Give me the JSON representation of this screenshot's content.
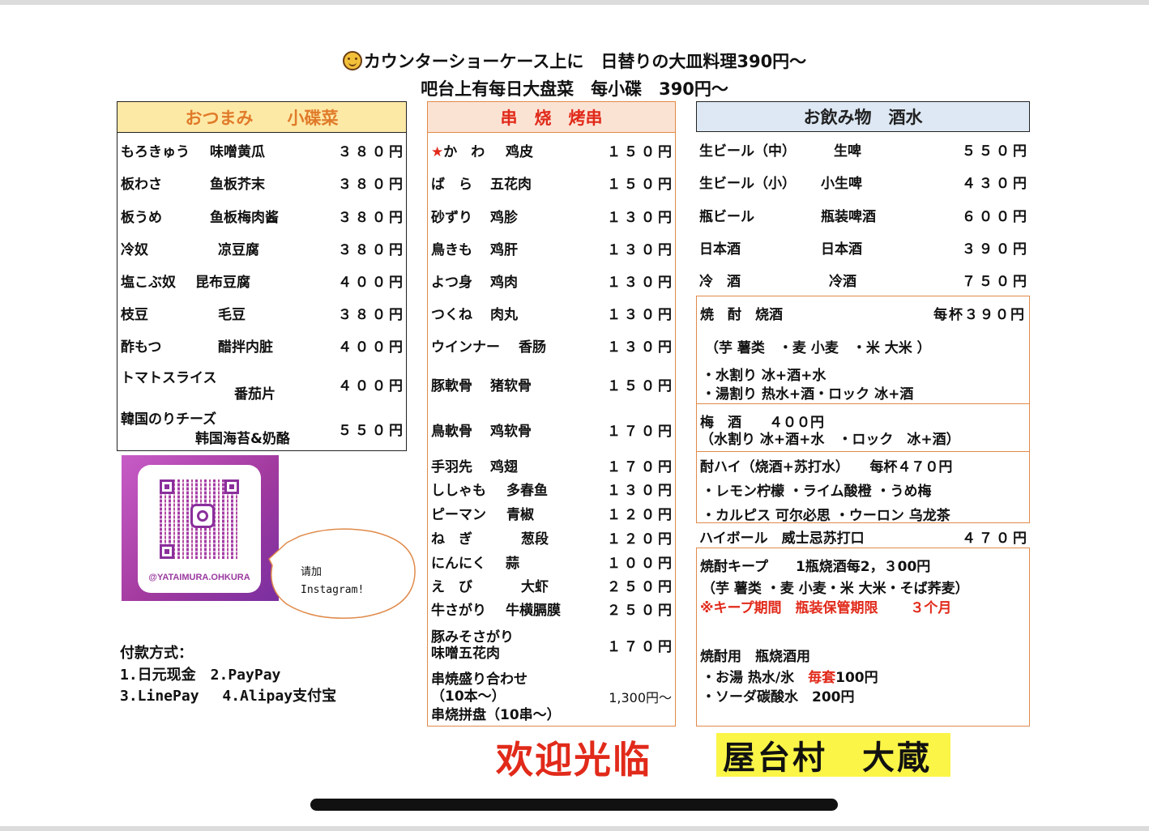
{
  "header": {
    "line1": "カウンターショーケース上に　日替りの大皿料理390円～",
    "line2": "吧台上有每日大盘菜　每小碟　390円～"
  },
  "snacks": {
    "title": "おつまみ　　小碟菜",
    "items": [
      {
        "jp": "もろきゅう",
        "cn": "味噌黄瓜",
        "price": "３８０円"
      },
      {
        "jp": "板わさ",
        "cn": "鱼板芥末",
        "price": "３８０円"
      },
      {
        "jp": "板うめ",
        "cn": "鱼板梅肉酱",
        "price": "３８０円"
      },
      {
        "jp": "冷奴",
        "cn": "凉豆腐",
        "price": "３８０円"
      },
      {
        "jp": "塩こぶ奴",
        "cn": "昆布豆腐",
        "price": "４００円"
      },
      {
        "jp": "枝豆",
        "cn": "毛豆",
        "price": "３８０円"
      },
      {
        "jp": "酢もつ",
        "cn": "醋拌内脏",
        "price": "４００円"
      },
      {
        "jp": "トマトスライス",
        "cn": "番茄片",
        "price": "４００円"
      },
      {
        "jp": "韓国のりチーズ",
        "cn": "韩国海苔&奶酪",
        "price": "５５０円"
      }
    ]
  },
  "skewers": {
    "title": "串　烧　烤串",
    "star": "★",
    "items": [
      {
        "jp": "か　わ",
        "cn": "鸡皮",
        "price": "１５０円"
      },
      {
        "jp": "ば　ら",
        "cn": "五花肉",
        "price": "１５０円"
      },
      {
        "jp": "砂ずり",
        "cn": "鸡胗",
        "price": "１３０円"
      },
      {
        "jp": "鳥きも",
        "cn": "鸡肝",
        "price": "１３０円"
      },
      {
        "jp": "よつ身",
        "cn": "鸡肉",
        "price": "１３０円"
      },
      {
        "jp": "つくね",
        "cn": "肉丸",
        "price": "１３０円"
      },
      {
        "jp": "ウインナー",
        "cn": "香肠",
        "price": "１３０円"
      },
      {
        "jp": "豚軟骨",
        "cn": "猪软骨",
        "price": "１５０円"
      },
      {
        "jp": "鳥軟骨",
        "cn": "鸡软骨",
        "price": "１７０円"
      },
      {
        "jp": "手羽先",
        "cn": "鸡翅",
        "price": "１７０円"
      },
      {
        "jp": "ししゃも",
        "cn": "多春鱼",
        "price": "１３０円"
      },
      {
        "jp": "ピーマン",
        "cn": "青椒",
        "price": "１２０円"
      },
      {
        "jp": "ね　ぎ",
        "cn": "葱段",
        "price": "１２０円"
      },
      {
        "jp": "にんにく",
        "cn": "蒜",
        "price": "１００円"
      },
      {
        "jp": "え　び",
        "cn": "大虾",
        "price": "２５０円"
      },
      {
        "jp": "牛さがり",
        "cn": "牛横膈膜",
        "price": "２５０円"
      }
    ],
    "pork": {
      "jp": "豚みそさがり",
      "cn": "味噌五花肉",
      "price": "１７０円"
    },
    "platter": {
      "jp1": "串焼盛り合わせ",
      "jp2": "（10本～）",
      "cn": "串烧拼盘（10串～）",
      "price": "1,300円～"
    }
  },
  "drinks": {
    "title": "お飲み物　酒水",
    "beers": [
      {
        "jp": "生ビール（中）",
        "cn": "生啤",
        "price": "５５０円"
      },
      {
        "jp": "生ビール（小）",
        "cn": "小生啤",
        "price": "４３０円"
      },
      {
        "jp": "瓶ビール",
        "cn": "瓶装啤酒",
        "price": "６００円"
      },
      {
        "jp": "日本酒",
        "cn": "日本酒",
        "price": "３９０円"
      },
      {
        "jp": "冷　酒",
        "cn": "冷酒",
        "price": "７５０円"
      }
    ],
    "shochu": {
      "title": "焼　酎　烧酒",
      "price": "每杯３９０円",
      "types": "（芋 薯类　・麦 小麦　・米 大米 ）",
      "style1": "・水割り 冰+酒+水",
      "style2": "・湯割り 热水+酒・ロック 冰+酒"
    },
    "ume": {
      "line1": "梅　酒　　４００円",
      "line2": "（水割り 冰+酒+水　・ロック　冰+酒）"
    },
    "chuhai": {
      "line1": "酎ハイ（烧酒+苏打水）　　每杯４７０円",
      "line2": "・レモン柠檬 ・ライム酸橙 ・うめ梅",
      "line3": "・カルピス 可尔必思 ・ウーロン 乌龙茶"
    },
    "highball": {
      "name": "ハイボール　威士忌苏打口",
      "price": "４７０円"
    },
    "keep": {
      "line1": "焼酎キープ　　1瓶烧酒每2，３00円",
      "line2": "（芋 薯类 ・麦 小麦・米 大米・そば荞麦）",
      "line3": "※キープ期間　瓶装保管期限　　 ３个月",
      "line4": "焼酎用　瓶烧酒用",
      "line5a": "・お湯 热水/氷　",
      "line5b": "毎套",
      "line5c": "100円",
      "line6": "・ソーダ碳酸水　200円"
    }
  },
  "qr": {
    "handle": "@YATAIMURA.OHKURA"
  },
  "bubble": {
    "line1": "请加",
    "line2": "Instagram!"
  },
  "payment": {
    "title": "付款方式：",
    "line1": "1.日元现金　2.PayPay",
    "line2": "3.LinePay　 4.Alipay支付宝"
  },
  "footer": {
    "welcome": "欢迎光临",
    "shop_name": "屋台村　大蔵"
  },
  "colors": {
    "accent_red": "#e12a1a",
    "orange": "#e07b2a",
    "highlight_yellow": "#fbf547"
  }
}
